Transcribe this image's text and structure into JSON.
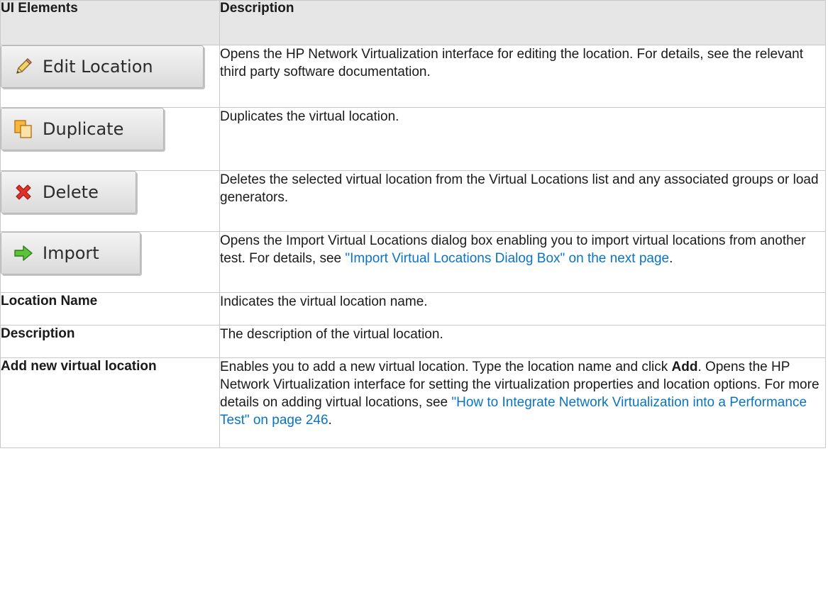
{
  "header": {
    "col_ui_elements": "UI Elements",
    "col_description": "Description"
  },
  "rows": {
    "edit": {
      "button_label": "Edit Location",
      "icon": "pencil-icon",
      "description": "Opens the HP Network Virtualization interface for editing the location. For details, see the relevant third party software documentation."
    },
    "duplicate": {
      "button_label": "Duplicate",
      "icon": "duplicate-icon",
      "description": "Duplicates the virtual location."
    },
    "delete": {
      "button_label": "Delete",
      "icon": "red-x-icon",
      "description": "Deletes the selected virtual location from the Virtual Locations list and any associated groups or load generators."
    },
    "import": {
      "button_label": "Import",
      "icon": "green-arrow-icon",
      "description_before": "Opens the Import Virtual Locations dialog box enabling you to import virtual locations from another test. For details, see ",
      "link_text": "\"Import Virtual Locations Dialog Box\" on the next page",
      "description_after": "."
    },
    "location_name": {
      "label": "Location Name",
      "description": "Indicates the virtual location name."
    },
    "description": {
      "label": "Description",
      "description": "The description of the virtual location."
    },
    "add_new": {
      "label": "Add new virtual location",
      "description_part1": "Enables you to add a new virtual location. Type the location name and click ",
      "bold_word": "Add",
      "description_part2": ". Opens the HP Network Virtualization interface for setting the virtualization properties and location options. For more details on adding virtual locations, see ",
      "link_text": "\"How to Integrate Network Virtualization into a Performance Test\" on page 246",
      "description_part3": "."
    }
  },
  "colors": {
    "header_bg": "#e6e6e6",
    "link": "#0a74c2",
    "border": "#c8c8c8"
  }
}
